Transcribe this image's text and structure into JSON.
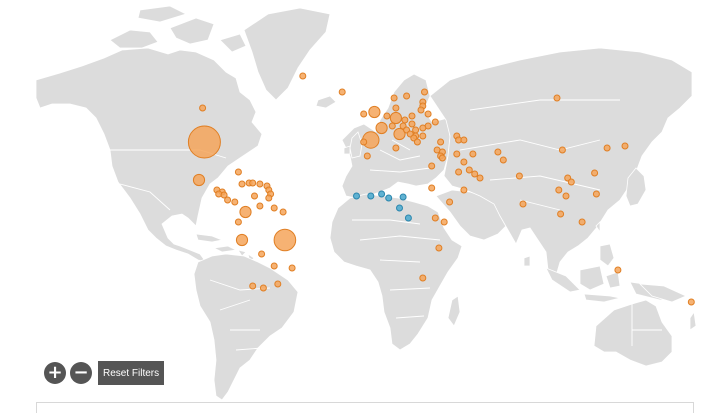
{
  "controls": {
    "zoom_in_label": "+",
    "zoom_out_label": "−",
    "reset_label": "Reset Filters"
  },
  "colors": {
    "land": "#dcdcdc",
    "ocean": "#ffffff",
    "marker_orange_fill": "#f5a55a",
    "marker_orange_stroke": "#e07f24",
    "marker_blue_fill": "#57aed0",
    "marker_blue_stroke": "#2b86ad",
    "button_bg": "#555555"
  },
  "map": {
    "projection": "equirectangular",
    "markers": [
      {
        "lat": 72,
        "lon": -42,
        "size": 1,
        "category": "orange"
      },
      {
        "lat": 64,
        "lon": -20,
        "size": 1,
        "category": "orange"
      },
      {
        "lat": 56,
        "lon": -98,
        "size": 1,
        "category": "orange"
      },
      {
        "lat": 39,
        "lon": -97,
        "size": 6,
        "category": "orange"
      },
      {
        "lat": 20,
        "lon": -100,
        "size": 2,
        "category": "orange"
      },
      {
        "lat": 24,
        "lon": -78,
        "size": 1,
        "category": "orange"
      },
      {
        "lat": 18,
        "lon": -76,
        "size": 1,
        "category": "orange"
      },
      {
        "lat": 18.5,
        "lon": -72,
        "size": 1,
        "category": "orange"
      },
      {
        "lat": 18.5,
        "lon": -70,
        "size": 1,
        "category": "orange"
      },
      {
        "lat": 18,
        "lon": -66,
        "size": 1,
        "category": "orange"
      },
      {
        "lat": 15,
        "lon": -90,
        "size": 1,
        "category": "orange"
      },
      {
        "lat": 14,
        "lon": -87,
        "size": 1,
        "category": "orange"
      },
      {
        "lat": 13,
        "lon": -89,
        "size": 1,
        "category": "orange"
      },
      {
        "lat": 12.5,
        "lon": -86,
        "size": 1,
        "category": "orange"
      },
      {
        "lat": 10,
        "lon": -84,
        "size": 1,
        "category": "orange"
      },
      {
        "lat": 9,
        "lon": -80,
        "size": 1,
        "category": "orange"
      },
      {
        "lat": 17,
        "lon": -62,
        "size": 1,
        "category": "orange"
      },
      {
        "lat": 15,
        "lon": -61,
        "size": 1,
        "category": "orange"
      },
      {
        "lat": 13,
        "lon": -60,
        "size": 1,
        "category": "orange"
      },
      {
        "lat": 11,
        "lon": -61,
        "size": 1,
        "category": "orange"
      },
      {
        "lat": 12,
        "lon": -69,
        "size": 1,
        "category": "orange"
      },
      {
        "lat": 7,
        "lon": -66,
        "size": 1,
        "category": "orange"
      },
      {
        "lat": 4,
        "lon": -74,
        "size": 2,
        "category": "orange"
      },
      {
        "lat": 6,
        "lon": -58,
        "size": 1,
        "category": "orange"
      },
      {
        "lat": 4,
        "lon": -53,
        "size": 1,
        "category": "orange"
      },
      {
        "lat": -1,
        "lon": -78,
        "size": 1,
        "category": "orange"
      },
      {
        "lat": -10,
        "lon": -76,
        "size": 2,
        "category": "orange"
      },
      {
        "lat": -10,
        "lon": -52,
        "size": 4,
        "category": "orange"
      },
      {
        "lat": -17,
        "lon": -65,
        "size": 1,
        "category": "orange"
      },
      {
        "lat": -23,
        "lon": -58,
        "size": 1,
        "category": "orange"
      },
      {
        "lat": -24,
        "lon": -48,
        "size": 1,
        "category": "orange"
      },
      {
        "lat": -33,
        "lon": -70,
        "size": 1,
        "category": "orange"
      },
      {
        "lat": -34,
        "lon": -64,
        "size": 1,
        "category": "orange"
      },
      {
        "lat": -32,
        "lon": -56,
        "size": 1,
        "category": "orange"
      },
      {
        "lat": 53,
        "lon": -8,
        "size": 1,
        "category": "orange"
      },
      {
        "lat": 54,
        "lon": -2,
        "size": 2,
        "category": "orange"
      },
      {
        "lat": 46,
        "lon": 2,
        "size": 2,
        "category": "orange"
      },
      {
        "lat": 40,
        "lon": -4,
        "size": 3,
        "category": "orange"
      },
      {
        "lat": 39,
        "lon": -8,
        "size": 1,
        "category": "orange"
      },
      {
        "lat": 52,
        "lon": 5,
        "size": 1,
        "category": "orange"
      },
      {
        "lat": 51,
        "lon": 10,
        "size": 2,
        "category": "orange"
      },
      {
        "lat": 47,
        "lon": 8,
        "size": 1,
        "category": "orange"
      },
      {
        "lat": 43,
        "lon": 12,
        "size": 2,
        "category": "orange"
      },
      {
        "lat": 56,
        "lon": 10,
        "size": 1,
        "category": "orange"
      },
      {
        "lat": 61,
        "lon": 9,
        "size": 1,
        "category": "orange"
      },
      {
        "lat": 62,
        "lon": 16,
        "size": 1,
        "category": "orange"
      },
      {
        "lat": 64,
        "lon": 26,
        "size": 1,
        "category": "orange"
      },
      {
        "lat": 59,
        "lon": 25,
        "size": 1,
        "category": "orange"
      },
      {
        "lat": 57,
        "lon": 25,
        "size": 1,
        "category": "orange"
      },
      {
        "lat": 55,
        "lon": 24,
        "size": 1,
        "category": "orange"
      },
      {
        "lat": 53,
        "lon": 28,
        "size": 1,
        "category": "orange"
      },
      {
        "lat": 52,
        "lon": 19,
        "size": 1,
        "category": "orange"
      },
      {
        "lat": 49,
        "lon": 32,
        "size": 1,
        "category": "orange"
      },
      {
        "lat": 50,
        "lon": 15,
        "size": 1,
        "category": "orange"
      },
      {
        "lat": 48,
        "lon": 19,
        "size": 1,
        "category": "orange"
      },
      {
        "lat": 47,
        "lon": 14,
        "size": 1,
        "category": "orange"
      },
      {
        "lat": 47,
        "lon": 28,
        "size": 1,
        "category": "orange"
      },
      {
        "lat": 46,
        "lon": 25,
        "size": 1,
        "category": "orange"
      },
      {
        "lat": 45,
        "lon": 21,
        "size": 1,
        "category": "orange"
      },
      {
        "lat": 45,
        "lon": 16,
        "size": 1,
        "category": "orange"
      },
      {
        "lat": 43,
        "lon": 18,
        "size": 1,
        "category": "orange"
      },
      {
        "lat": 42,
        "lon": 21,
        "size": 1,
        "category": "orange"
      },
      {
        "lat": 42,
        "lon": 25,
        "size": 1,
        "category": "orange"
      },
      {
        "lat": 41,
        "lon": 20,
        "size": 1,
        "category": "orange"
      },
      {
        "lat": 39,
        "lon": 22,
        "size": 1,
        "category": "orange"
      },
      {
        "lat": 39,
        "lon": 35,
        "size": 1,
        "category": "orange"
      },
      {
        "lat": 35,
        "lon": 33,
        "size": 1,
        "category": "orange"
      },
      {
        "lat": 42,
        "lon": 44,
        "size": 1,
        "category": "orange"
      },
      {
        "lat": 40,
        "lon": 45,
        "size": 1,
        "category": "orange"
      },
      {
        "lat": 40,
        "lon": 48,
        "size": 1,
        "category": "orange"
      },
      {
        "lat": 34,
        "lon": 36,
        "size": 1,
        "category": "orange"
      },
      {
        "lat": 32,
        "lon": 35,
        "size": 1,
        "category": "orange"
      },
      {
        "lat": 31,
        "lon": 36,
        "size": 1,
        "category": "orange"
      },
      {
        "lat": 33,
        "lon": 44,
        "size": 1,
        "category": "orange"
      },
      {
        "lat": 36,
        "lon": 10,
        "size": 1,
        "category": "orange"
      },
      {
        "lat": 32,
        "lon": -6,
        "size": 1,
        "category": "orange"
      },
      {
        "lat": 27,
        "lon": 30,
        "size": 1,
        "category": "orange"
      },
      {
        "lat": 16,
        "lon": 30,
        "size": 1,
        "category": "orange"
      },
      {
        "lat": 24,
        "lon": 45,
        "size": 1,
        "category": "orange"
      },
      {
        "lat": 23,
        "lon": 54,
        "size": 1,
        "category": "orange"
      },
      {
        "lat": 25,
        "lon": 51,
        "size": 1,
        "category": "orange"
      },
      {
        "lat": 29,
        "lon": 48,
        "size": 1,
        "category": "orange"
      },
      {
        "lat": 21,
        "lon": 57,
        "size": 1,
        "category": "orange"
      },
      {
        "lat": 15,
        "lon": 48,
        "size": 1,
        "category": "orange"
      },
      {
        "lat": 33,
        "lon": 53,
        "size": 1,
        "category": "orange"
      },
      {
        "lat": 34,
        "lon": 67,
        "size": 1,
        "category": "orange"
      },
      {
        "lat": 30,
        "lon": 70,
        "size": 1,
        "category": "orange"
      },
      {
        "lat": 22,
        "lon": 79,
        "size": 1,
        "category": "orange"
      },
      {
        "lat": 8,
        "lon": 81,
        "size": 1,
        "category": "orange"
      },
      {
        "lat": 9,
        "lon": 40,
        "size": 1,
        "category": "orange"
      },
      {
        "lat": 1,
        "lon": 32,
        "size": 1,
        "category": "orange"
      },
      {
        "lat": -1,
        "lon": 37,
        "size": 1,
        "category": "orange"
      },
      {
        "lat": -14,
        "lon": 34,
        "size": 1,
        "category": "orange"
      },
      {
        "lat": -29,
        "lon": 25,
        "size": 1,
        "category": "orange"
      },
      {
        "lat": 61,
        "lon": 100,
        "size": 1,
        "category": "orange"
      },
      {
        "lat": 35,
        "lon": 103,
        "size": 1,
        "category": "orange"
      },
      {
        "lat": 36,
        "lon": 128,
        "size": 1,
        "category": "orange"
      },
      {
        "lat": 37,
        "lon": 138,
        "size": 1,
        "category": "orange"
      },
      {
        "lat": 23.5,
        "lon": 121,
        "size": 1,
        "category": "orange"
      },
      {
        "lat": 21,
        "lon": 106,
        "size": 1,
        "category": "orange"
      },
      {
        "lat": 19,
        "lon": 108,
        "size": 1,
        "category": "orange"
      },
      {
        "lat": 15,
        "lon": 101,
        "size": 1,
        "category": "orange"
      },
      {
        "lat": 12,
        "lon": 105,
        "size": 1,
        "category": "orange"
      },
      {
        "lat": 13,
        "lon": 122,
        "size": 1,
        "category": "orange"
      },
      {
        "lat": 3,
        "lon": 102,
        "size": 1,
        "category": "orange"
      },
      {
        "lat": -1,
        "lon": 114,
        "size": 1,
        "category": "orange"
      },
      {
        "lat": -25,
        "lon": 134,
        "size": 1,
        "category": "orange"
      },
      {
        "lat": -41,
        "lon": 175,
        "size": 1,
        "category": "orange"
      },
      {
        "lat": 12,
        "lon": -12,
        "size": 1,
        "category": "blue"
      },
      {
        "lat": 12,
        "lon": -4,
        "size": 1,
        "category": "blue"
      },
      {
        "lat": 13,
        "lon": 2,
        "size": 1,
        "category": "blue"
      },
      {
        "lat": 11,
        "lon": 6,
        "size": 1,
        "category": "blue"
      },
      {
        "lat": 11.5,
        "lon": 14,
        "size": 1,
        "category": "blue"
      },
      {
        "lat": 6,
        "lon": 12,
        "size": 1,
        "category": "blue"
      },
      {
        "lat": 1,
        "lon": 17,
        "size": 1,
        "category": "blue"
      }
    ]
  }
}
